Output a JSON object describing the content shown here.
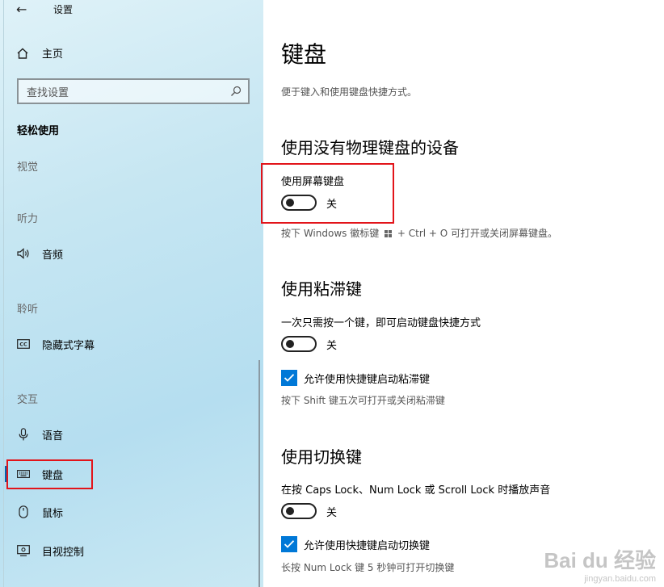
{
  "window": {
    "title": "设置"
  },
  "sidebar": {
    "home_label": "主页",
    "search_placeholder": "查找设置",
    "section_title": "轻松使用",
    "groups": [
      {
        "heading": "视觉"
      },
      {
        "heading": "听力",
        "items": [
          {
            "label": "音频",
            "icon": "speaker-icon"
          }
        ]
      },
      {
        "heading": "聆听",
        "items": [
          {
            "label": "隐藏式字幕",
            "icon": "closed-caption-icon"
          }
        ]
      },
      {
        "heading": "交互",
        "items": [
          {
            "label": "语音",
            "icon": "microphone-icon"
          },
          {
            "label": "键盘",
            "icon": "keyboard-icon",
            "selected": true
          },
          {
            "label": "鼠标",
            "icon": "mouse-icon"
          },
          {
            "label": "目视控制",
            "icon": "eye-control-icon"
          }
        ]
      }
    ]
  },
  "main": {
    "title": "键盘",
    "description": "便于键入和使用键盘快捷方式。",
    "sections": [
      {
        "heading": "使用没有物理键盘的设备",
        "toggle_label": "使用屏幕键盘",
        "toggle_state": "关",
        "hint_prefix": "按下 Windows 徽标键",
        "hint_suffix": "+ Ctrl + O 可打开或关闭屏幕键盘。"
      },
      {
        "heading": "使用粘滞键",
        "toggle_label": "一次只需按一个键，即可启动键盘快捷方式",
        "toggle_state": "关",
        "checkbox_label": "允许使用快捷键启动粘滞键",
        "hint": "按下 Shift 键五次可打开或关闭粘滞键"
      },
      {
        "heading": "使用切换键",
        "toggle_label": "在按 Caps Lock、Num Lock 或 Scroll Lock 时播放声音",
        "toggle_state": "关",
        "checkbox_label": "允许使用快捷键启动切换键",
        "hint": "长按 Num Lock 键 5 秒钟可打开切换键"
      }
    ]
  },
  "watermark": {
    "main": "Bai du 经验",
    "sub": "jingyan.baidu.com"
  },
  "colors": {
    "accent": "#0078d7",
    "highlight_box": "#e2141a"
  }
}
